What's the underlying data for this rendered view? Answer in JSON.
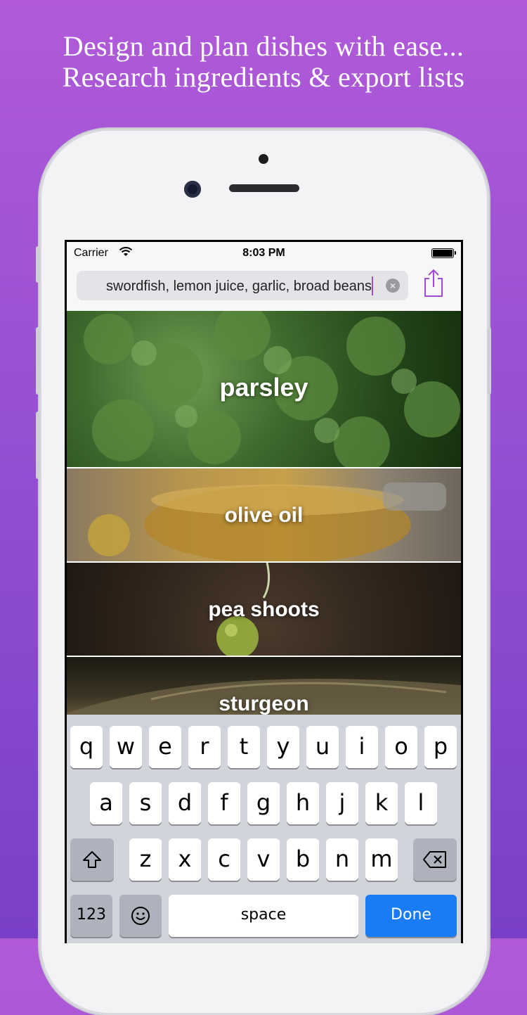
{
  "headline": {
    "line1": "Design and plan dishes with ease...",
    "line2": "Research ingredients & export lists"
  },
  "status_bar": {
    "carrier": "Carrier",
    "time": "8:03 PM"
  },
  "search": {
    "value": "swordfish, lemon juice, garlic, broad beans"
  },
  "ingredients": [
    {
      "label": "parsley",
      "color": "#3e6a2e"
    },
    {
      "label": "olive oil",
      "color": "#9a7a3c"
    },
    {
      "label": "pea shoots",
      "color": "#3a2c22"
    },
    {
      "label": "sturgeon",
      "color": "#2a2418"
    }
  ],
  "keyboard": {
    "row1": [
      "q",
      "w",
      "e",
      "r",
      "t",
      "y",
      "u",
      "i",
      "o",
      "p"
    ],
    "row2": [
      "a",
      "s",
      "d",
      "f",
      "g",
      "h",
      "j",
      "k",
      "l"
    ],
    "row3": [
      "z",
      "x",
      "c",
      "v",
      "b",
      "n",
      "m"
    ],
    "numbers_label": "123",
    "space_label": "space",
    "done_label": "Done"
  },
  "colors": {
    "accent": "#a04ad6",
    "done_blue": "#1a7cf5",
    "background_top": "#b05ad8",
    "background_bottom": "#7a3fc8"
  }
}
